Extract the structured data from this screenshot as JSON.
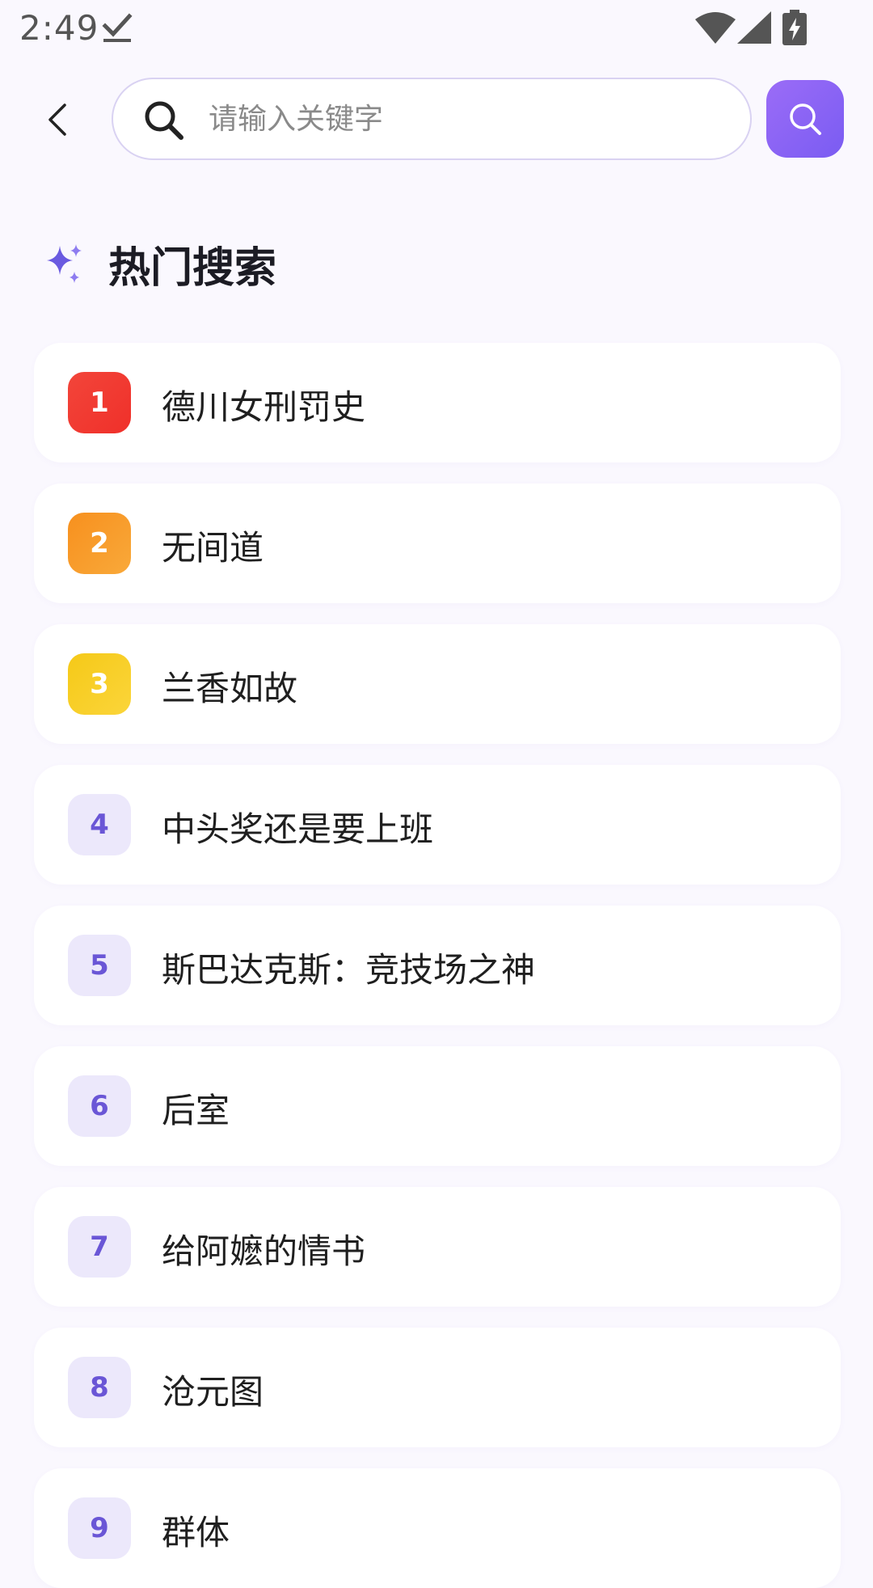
{
  "status_bar": {
    "time": "2:49",
    "icons": [
      "check-icon",
      "wifi-icon",
      "signal-icon",
      "battery-charging-icon"
    ]
  },
  "search": {
    "placeholder": "请输入关键字",
    "value": ""
  },
  "section": {
    "title": "热门搜索",
    "icon": "sparkle-icon"
  },
  "colors": {
    "accent": "#8b63f4",
    "rank1": "#f2453a",
    "rank2": "#f7901e",
    "rank3": "#f5c918",
    "rank_other_bg": "#ece8fb",
    "rank_other_text": "#6a56d6"
  },
  "hot_searches": [
    {
      "rank": "1",
      "title": "德川女刑罚史"
    },
    {
      "rank": "2",
      "title": "无间道"
    },
    {
      "rank": "3",
      "title": "兰香如故"
    },
    {
      "rank": "4",
      "title": "中头奖还是要上班"
    },
    {
      "rank": "5",
      "title": "斯巴达克斯：竞技场之神"
    },
    {
      "rank": "6",
      "title": "后室"
    },
    {
      "rank": "7",
      "title": "给阿嬷的情书"
    },
    {
      "rank": "8",
      "title": "沧元图"
    },
    {
      "rank": "9",
      "title": "群体"
    }
  ]
}
